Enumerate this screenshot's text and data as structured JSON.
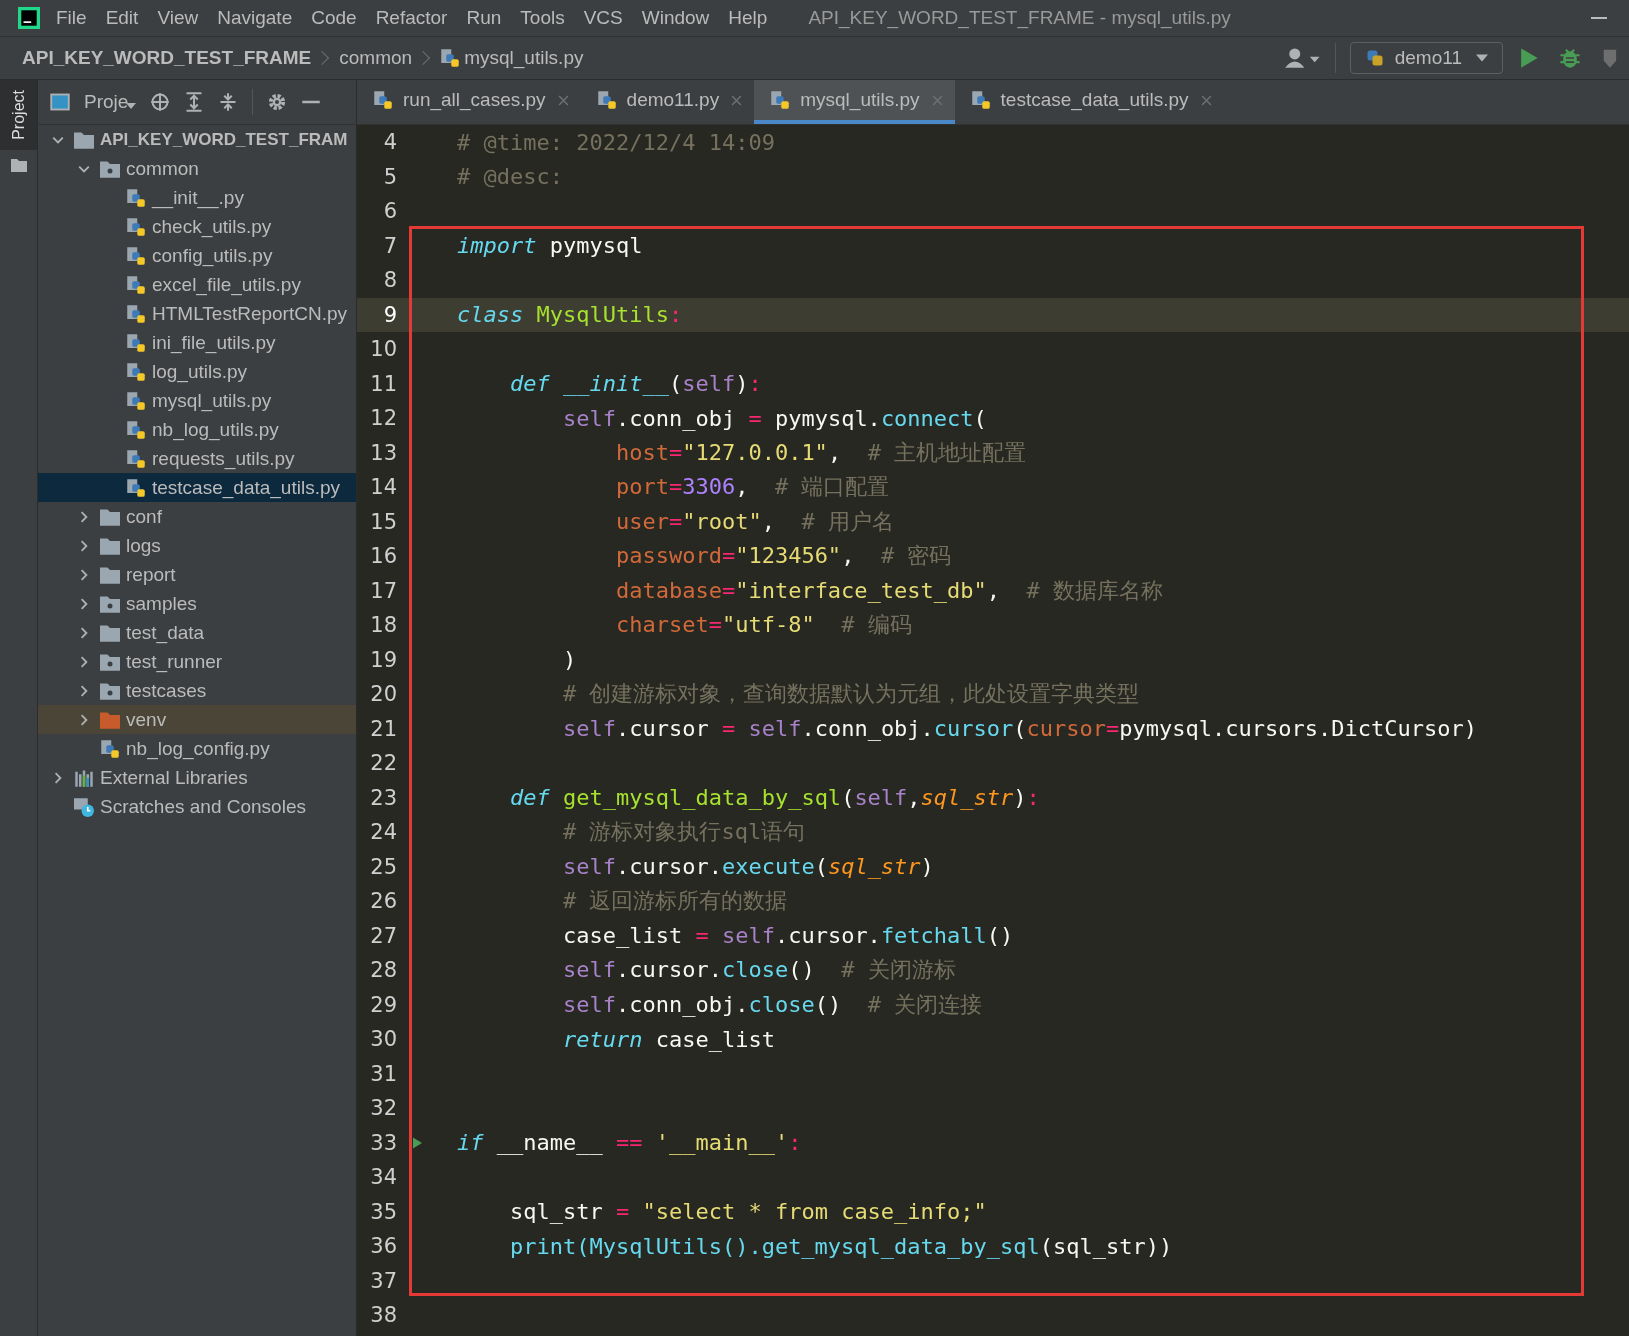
{
  "menu": [
    "File",
    "Edit",
    "View",
    "Navigate",
    "Code",
    "Refactor",
    "Run",
    "Tools",
    "VCS",
    "Window",
    "Help"
  ],
  "window_title": "API_KEY_WORD_TEST_FRAME - mysql_utils.py",
  "breadcrumb": [
    "API_KEY_WORD_TEST_FRAME",
    "common",
    "mysql_utils.py"
  ],
  "run_config": "demo11",
  "side_tab": "Project",
  "project_panel": {
    "title": "Proje"
  },
  "tree": [
    {
      "label": "API_KEY_WORD_TEST_FRAM",
      "kind": "project",
      "expanded": true,
      "selected": false,
      "children": [
        {
          "label": "common",
          "kind": "package",
          "expanded": true,
          "selected": false,
          "children": [
            {
              "label": "__init__.py",
              "kind": "python",
              "selected": false
            },
            {
              "label": "check_utils.py",
              "kind": "python",
              "selected": false
            },
            {
              "label": "config_utils.py",
              "kind": "python",
              "selected": false
            },
            {
              "label": "excel_file_utils.py",
              "kind": "python",
              "selected": false
            },
            {
              "label": "HTMLTestReportCN.py",
              "kind": "python",
              "selected": false
            },
            {
              "label": "ini_file_utils.py",
              "kind": "python",
              "selected": false
            },
            {
              "label": "log_utils.py",
              "kind": "python",
              "selected": false
            },
            {
              "label": "mysql_utils.py",
              "kind": "python",
              "selected": false
            },
            {
              "label": "nb_log_utils.py",
              "kind": "python",
              "selected": false
            },
            {
              "label": "requests_utils.py",
              "kind": "python",
              "selected": false
            },
            {
              "label": "testcase_data_utils.py",
              "kind": "python",
              "selected": true
            }
          ]
        },
        {
          "label": "conf",
          "kind": "folder",
          "expanded": false,
          "selected": false
        },
        {
          "label": "logs",
          "kind": "folder",
          "expanded": false,
          "selected": false
        },
        {
          "label": "report",
          "kind": "folder",
          "expanded": false,
          "selected": false
        },
        {
          "label": "samples",
          "kind": "package",
          "expanded": false,
          "selected": false
        },
        {
          "label": "test_data",
          "kind": "folder",
          "expanded": false,
          "selected": false
        },
        {
          "label": "test_runner",
          "kind": "package",
          "expanded": false,
          "selected": false
        },
        {
          "label": "testcases",
          "kind": "package",
          "expanded": false,
          "selected": false
        },
        {
          "label": "venv",
          "kind": "excluded",
          "expanded": false,
          "selected": false
        },
        {
          "label": "nb_log_config.py",
          "kind": "python",
          "selected": false
        }
      ]
    },
    {
      "label": "External Libraries",
      "kind": "libraries",
      "expanded": false,
      "selected": false
    },
    {
      "label": "Scratches and Consoles",
      "kind": "scratches",
      "selected": false
    }
  ],
  "tabs": [
    {
      "label": "run_all_cases.py",
      "selected": false
    },
    {
      "label": "demo11.py",
      "selected": false
    },
    {
      "label": "mysql_utils.py",
      "selected": true
    },
    {
      "label": "testcase_data_utils.py",
      "selected": false
    }
  ],
  "code": [
    {
      "number": "4",
      "current": false,
      "tokens": [
        {
          "kind": "comment",
          "text": "# @time: 2022/12/4 14:09"
        }
      ]
    },
    {
      "number": "5",
      "current": false,
      "tokens": [
        {
          "kind": "comment",
          "text": "# @desc:"
        }
      ]
    },
    {
      "number": "6",
      "current": false
    },
    {
      "number": "7",
      "current": false,
      "tokens": [
        {
          "kind": "keyword",
          "text": "import"
        },
        {
          "kind": "plain",
          "text": " pymysql"
        }
      ]
    },
    {
      "number": "8",
      "current": false
    },
    {
      "number": "9",
      "current": true,
      "tokens": [
        {
          "kind": "keyword",
          "text": "class "
        },
        {
          "kind": "def",
          "text": "MysqlUtils"
        },
        {
          "kind": "op",
          "text": ":"
        }
      ]
    },
    {
      "number": "10",
      "current": false
    },
    {
      "number": "11",
      "current": false,
      "tokens": [
        {
          "kind": "keyword",
          "text": "    def "
        },
        {
          "kind": "magic",
          "text": "__init__"
        },
        {
          "kind": "plain",
          "text": "("
        },
        {
          "kind": "self",
          "text": "self"
        },
        {
          "kind": "plain",
          "text": ")"
        },
        {
          "kind": "op",
          "text": ":"
        }
      ]
    },
    {
      "number": "12",
      "current": false,
      "tokens": [
        {
          "kind": "self",
          "text": "        self"
        },
        {
          "kind": "plain",
          "text": ".conn_obj "
        },
        {
          "kind": "op",
          "text": "= "
        },
        {
          "kind": "plain",
          "text": "pymysql."
        },
        {
          "kind": "call",
          "text": "connect"
        },
        {
          "kind": "plain",
          "text": "("
        }
      ]
    },
    {
      "number": "13",
      "current": false,
      "tokens": [
        {
          "kind": "kwarg",
          "text": "            host"
        },
        {
          "kind": "op",
          "text": "="
        },
        {
          "kind": "string",
          "text": "\"127.0.0.1\""
        },
        {
          "kind": "plain",
          "text": ",  "
        },
        {
          "kind": "comment",
          "text": "# 主机地址配置"
        }
      ]
    },
    {
      "number": "14",
      "current": false,
      "tokens": [
        {
          "kind": "kwarg",
          "text": "            port"
        },
        {
          "kind": "op",
          "text": "="
        },
        {
          "kind": "number",
          "text": "3306"
        },
        {
          "kind": "plain",
          "text": ",  "
        },
        {
          "kind": "comment",
          "text": "# 端口配置"
        }
      ]
    },
    {
      "number": "15",
      "current": false,
      "tokens": [
        {
          "kind": "kwarg",
          "text": "            user"
        },
        {
          "kind": "op",
          "text": "="
        },
        {
          "kind": "string",
          "text": "\"root\""
        },
        {
          "kind": "plain",
          "text": ",  "
        },
        {
          "kind": "comment",
          "text": "# 用户名"
        }
      ]
    },
    {
      "number": "16",
      "current": false,
      "tokens": [
        {
          "kind": "kwarg",
          "text": "            password"
        },
        {
          "kind": "op",
          "text": "="
        },
        {
          "kind": "string",
          "text": "\"123456\""
        },
        {
          "kind": "plain",
          "text": ",  "
        },
        {
          "kind": "comment",
          "text": "# 密码"
        }
      ]
    },
    {
      "number": "17",
      "current": false,
      "tokens": [
        {
          "kind": "kwarg",
          "text": "            database"
        },
        {
          "kind": "op",
          "text": "="
        },
        {
          "kind": "string",
          "text": "\"interface_test_db\""
        },
        {
          "kind": "plain",
          "text": ",  "
        },
        {
          "kind": "comment",
          "text": "# 数据库名称"
        }
      ]
    },
    {
      "number": "18",
      "current": false,
      "tokens": [
        {
          "kind": "kwarg",
          "text": "            charset"
        },
        {
          "kind": "op",
          "text": "="
        },
        {
          "kind": "string",
          "text": "\"utf-8\"  "
        },
        {
          "kind": "comment",
          "text": "# 编码"
        }
      ]
    },
    {
      "number": "19",
      "current": false,
      "tokens": [
        {
          "kind": "plain",
          "text": "        )"
        }
      ]
    },
    {
      "number": "20",
      "current": false,
      "tokens": [
        {
          "kind": "comment",
          "text": "        # 创建游标对象，查询数据默认为元组，此处设置字典类型"
        }
      ]
    },
    {
      "number": "21",
      "current": false,
      "tokens": [
        {
          "kind": "self",
          "text": "        self"
        },
        {
          "kind": "plain",
          "text": ".cursor "
        },
        {
          "kind": "op",
          "text": "= "
        },
        {
          "kind": "self",
          "text": "self"
        },
        {
          "kind": "plain",
          "text": ".conn_obj."
        },
        {
          "kind": "call",
          "text": "cursor"
        },
        {
          "kind": "plain",
          "text": "("
        },
        {
          "kind": "kwarg",
          "text": "cursor"
        },
        {
          "kind": "op",
          "text": "="
        },
        {
          "kind": "plain",
          "text": "pymysql.cursors.DictCursor)"
        }
      ]
    },
    {
      "number": "22",
      "current": false
    },
    {
      "number": "23",
      "current": false,
      "tokens": [
        {
          "kind": "keyword",
          "text": "    def "
        },
        {
          "kind": "def",
          "text": "get_mysql_data_by_sql"
        },
        {
          "kind": "plain",
          "text": "("
        },
        {
          "kind": "self",
          "text": "self"
        },
        {
          "kind": "plain",
          "text": ","
        },
        {
          "kind": "param",
          "text": "sql_str"
        },
        {
          "kind": "plain",
          "text": ")"
        },
        {
          "kind": "op",
          "text": ":"
        }
      ]
    },
    {
      "number": "24",
      "current": false,
      "tokens": [
        {
          "kind": "comment",
          "text": "        # 游标对象执行sql语句"
        }
      ]
    },
    {
      "number": "25",
      "current": false,
      "tokens": [
        {
          "kind": "self",
          "text": "        self"
        },
        {
          "kind": "plain",
          "text": ".cursor."
        },
        {
          "kind": "call",
          "text": "execute"
        },
        {
          "kind": "plain",
          "text": "("
        },
        {
          "kind": "param",
          "text": "sql_str"
        },
        {
          "kind": "plain",
          "text": ")"
        }
      ]
    },
    {
      "number": "26",
      "current": false,
      "tokens": [
        {
          "kind": "comment",
          "text": "        # 返回游标所有的数据"
        }
      ]
    },
    {
      "number": "27",
      "current": false,
      "tokens": [
        {
          "kind": "plain",
          "text": "        case_list "
        },
        {
          "kind": "op",
          "text": "= "
        },
        {
          "kind": "self",
          "text": "self"
        },
        {
          "kind": "plain",
          "text": ".cursor."
        },
        {
          "kind": "call",
          "text": "fetchall"
        },
        {
          "kind": "plain",
          "text": "()"
        }
      ]
    },
    {
      "number": "28",
      "current": false,
      "tokens": [
        {
          "kind": "self",
          "text": "        self"
        },
        {
          "kind": "plain",
          "text": ".cursor."
        },
        {
          "kind": "call",
          "text": "close"
        },
        {
          "kind": "plain",
          "text": "()  "
        },
        {
          "kind": "comment",
          "text": "# 关闭游标"
        }
      ]
    },
    {
      "number": "29",
      "current": false,
      "tokens": [
        {
          "kind": "self",
          "text": "        self"
        },
        {
          "kind": "plain",
          "text": ".conn_obj."
        },
        {
          "kind": "call",
          "text": "close"
        },
        {
          "kind": "plain",
          "text": "()  "
        },
        {
          "kind": "comment",
          "text": "# 关闭连接"
        }
      ]
    },
    {
      "number": "30",
      "current": false,
      "tokens": [
        {
          "kind": "keyword",
          "text": "        return"
        },
        {
          "kind": "plain",
          "text": " case_list"
        }
      ]
    },
    {
      "number": "31",
      "current": false
    },
    {
      "number": "32",
      "current": false
    },
    {
      "number": "33",
      "current": false,
      "run_marker": true,
      "tokens": [
        {
          "kind": "keyword",
          "text": "if"
        },
        {
          "kind": "plain",
          "text": " __name__ "
        },
        {
          "kind": "op",
          "text": "== "
        },
        {
          "kind": "string",
          "text": "'__main__'"
        },
        {
          "kind": "op",
          "text": ":"
        }
      ]
    },
    {
      "number": "34",
      "current": false
    },
    {
      "number": "35",
      "current": false,
      "tokens": [
        {
          "kind": "plain",
          "text": "    sql_str "
        },
        {
          "kind": "op",
          "text": "= "
        },
        {
          "kind": "string",
          "text": "\"select * from case_info;\""
        }
      ]
    },
    {
      "number": "36",
      "current": false,
      "tokens": [
        {
          "kind": "call",
          "text": "    print(MysqlUtils().get_mysql_data_by_sql"
        },
        {
          "kind": "plain",
          "text": "(sql_str))"
        }
      ]
    },
    {
      "number": "37",
      "current": false
    },
    {
      "number": "38",
      "current": false
    }
  ]
}
